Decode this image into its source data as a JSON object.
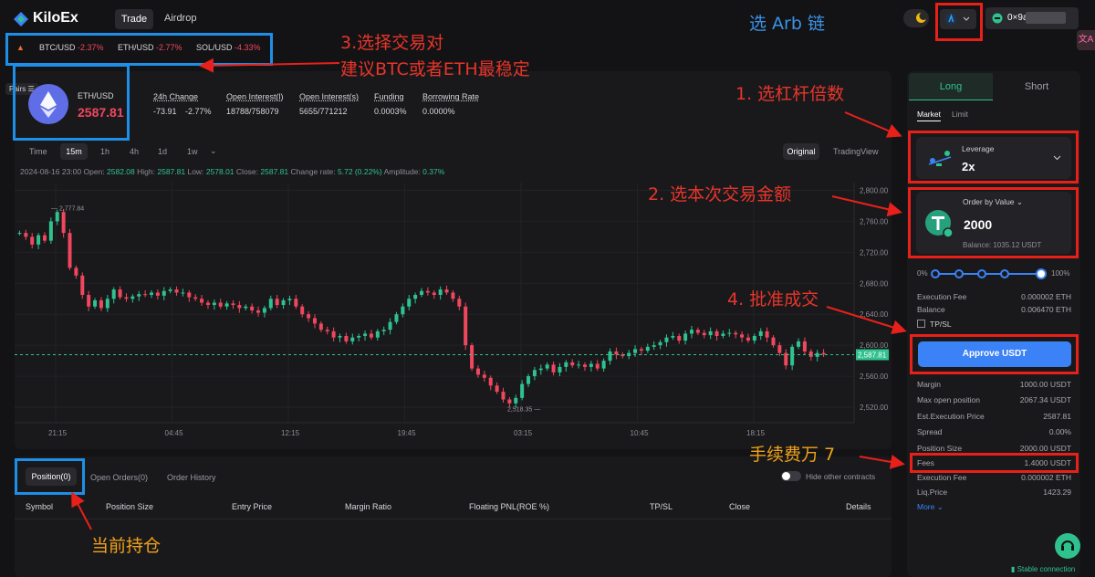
{
  "nav": {
    "brand": "KiloEx",
    "tabs": [
      "Trade",
      "Airdrop"
    ],
    "wallet": "0×9a"
  },
  "lang": "文A",
  "ticker": [
    {
      "pair": "BTC/USD",
      "change": "-2.37%"
    },
    {
      "pair": "ETH/USD",
      "change": "-2.77%"
    },
    {
      "pair": "SOL/USD",
      "change": "-4.33%"
    }
  ],
  "pairs_label": "Pairs",
  "market": {
    "pair": "ETH/USD",
    "price": "2587.81",
    "change_label": "24h Change",
    "change_abs": "-73.91",
    "change_pct": "-2.77%",
    "oi_l_label": "Open Interest(l)",
    "oi_l": "18788/758079",
    "oi_s_label": "Open Interest(s)",
    "oi_s": "5655/771212",
    "funding_label": "Funding",
    "funding": "0.0003%",
    "borrow_label": "Borrowing Rate",
    "borrow": "0.0000%"
  },
  "timeframes": [
    "Time",
    "15m",
    "1h",
    "4h",
    "1d",
    "1w"
  ],
  "views": [
    "Original",
    "TradingView"
  ],
  "ohlc": {
    "date": "2024-08-16 23:00",
    "open_label": "Open:",
    "open": "2582.08",
    "high_label": "High:",
    "high": "2587.81",
    "low_label": "Low:",
    "low": "2578.01",
    "close_label": "Close:",
    "close": "2587.81",
    "change_label": "Change rate:",
    "change": "5.72 (0.22%)",
    "amp_label": "Amplitude:",
    "amp": "0.37%"
  },
  "chart_data": {
    "type": "candlestick",
    "y_ticks": [
      "2,800.00",
      "2,760.00",
      "2,720.00",
      "2,680.00",
      "2,640.00",
      "2,600.00",
      "2,560.00",
      "2,520.00"
    ],
    "x_ticks": [
      "21:15",
      "04:45",
      "12:15",
      "19:45",
      "03:15",
      "10:45",
      "18:15"
    ],
    "ylim": [
      2500,
      2810
    ],
    "last_price": "2,587.81",
    "high_label": "2,777.84",
    "low_label": "2,518.35",
    "close_path": [
      2745,
      2740,
      2730,
      2742,
      2735,
      2760,
      2772,
      2745,
      2700,
      2690,
      2665,
      2650,
      2658,
      2648,
      2660,
      2672,
      2662,
      2660,
      2663,
      2666,
      2665,
      2668,
      2664,
      2670,
      2672,
      2668,
      2668,
      2662,
      2660,
      2655,
      2652,
      2655,
      2650,
      2654,
      2652,
      2648,
      2650,
      2645,
      2642,
      2648,
      2660,
      2652,
      2658,
      2660,
      2650,
      2640,
      2635,
      2628,
      2620,
      2618,
      2610,
      2612,
      2605,
      2610,
      2612,
      2615,
      2610,
      2618,
      2620,
      2630,
      2640,
      2650,
      2660,
      2665,
      2670,
      2668,
      2665,
      2672,
      2668,
      2660,
      2650,
      2600,
      2570,
      2562,
      2558,
      2548,
      2540,
      2530,
      2525,
      2532,
      2550,
      2560,
      2568,
      2570,
      2575,
      2565,
      2572,
      2578,
      2574,
      2575,
      2572,
      2576,
      2570,
      2580,
      2592,
      2588,
      2586,
      2590,
      2595,
      2593,
      2598,
      2600,
      2604,
      2610,
      2612,
      2606,
      2615,
      2620,
      2616,
      2613,
      2618,
      2612,
      2615,
      2616,
      2614,
      2610,
      2606,
      2612,
      2618,
      2610,
      2600,
      2590,
      2574,
      2598,
      2605,
      2592,
      2585,
      2590,
      2588
    ]
  },
  "bottom": {
    "tabs": [
      "Position(0)",
      "Open Orders(0)",
      "Order History"
    ],
    "hide_label": "Hide other contracts",
    "columns": [
      "Symbol",
      "Position Size",
      "Entry Price",
      "Margin Ratio",
      "Floating PNL(ROE %)",
      "TP/SL",
      "Close",
      "Details"
    ]
  },
  "order": {
    "long": "Long",
    "short": "Short",
    "market": "Market",
    "limit": "Limit",
    "leverage_label": "Leverage",
    "leverage": "2x",
    "order_by": "Order by Value",
    "amount": "2000",
    "balance": "Balance: 1035.12 USDT",
    "slider_min": "0%",
    "slider_max": "100%",
    "exec_fee_label": "Execution Fee",
    "exec_fee": "0.000002 ETH",
    "balance_label": "Balance",
    "balance_eth": "0.006470 ETH",
    "tpsl": "TP/SL",
    "approve": "Approve USDT",
    "rows": [
      {
        "label": "Margin",
        "value": "1000.00 USDT"
      },
      {
        "label": "Max open position",
        "value": "2067.34 USDT"
      },
      {
        "label": "Est.Execution Price",
        "value": "2587.81"
      },
      {
        "label": "Spread",
        "value": "0.00%"
      },
      {
        "label": "Position Size",
        "value": "2000.00 USDT"
      },
      {
        "label": "Fees",
        "value": "1.4000 USDT"
      },
      {
        "label": "Execution Fee",
        "value": "0.000002 ETH"
      },
      {
        "label": "Liq.Price",
        "value": "1423.29"
      }
    ],
    "more": "More",
    "status": "Stable connection"
  },
  "annotations": {
    "arb": "选 Arb 链",
    "pair1": "3.选择交易对",
    "pair2": "建议BTC或者ETH最稳定",
    "leverage": "1. 选杠杆倍数",
    "amount": "2. 选本次交易金额",
    "approve": "4. 批准成交",
    "fees": "手续费万 7",
    "position": "当前持仓"
  },
  "colors": {
    "up": "#2fc28f",
    "down": "#f0475d",
    "accent": "#3b82f6",
    "annotation_red": "#e8201a",
    "annotation_blue": "#1e8fe8"
  }
}
